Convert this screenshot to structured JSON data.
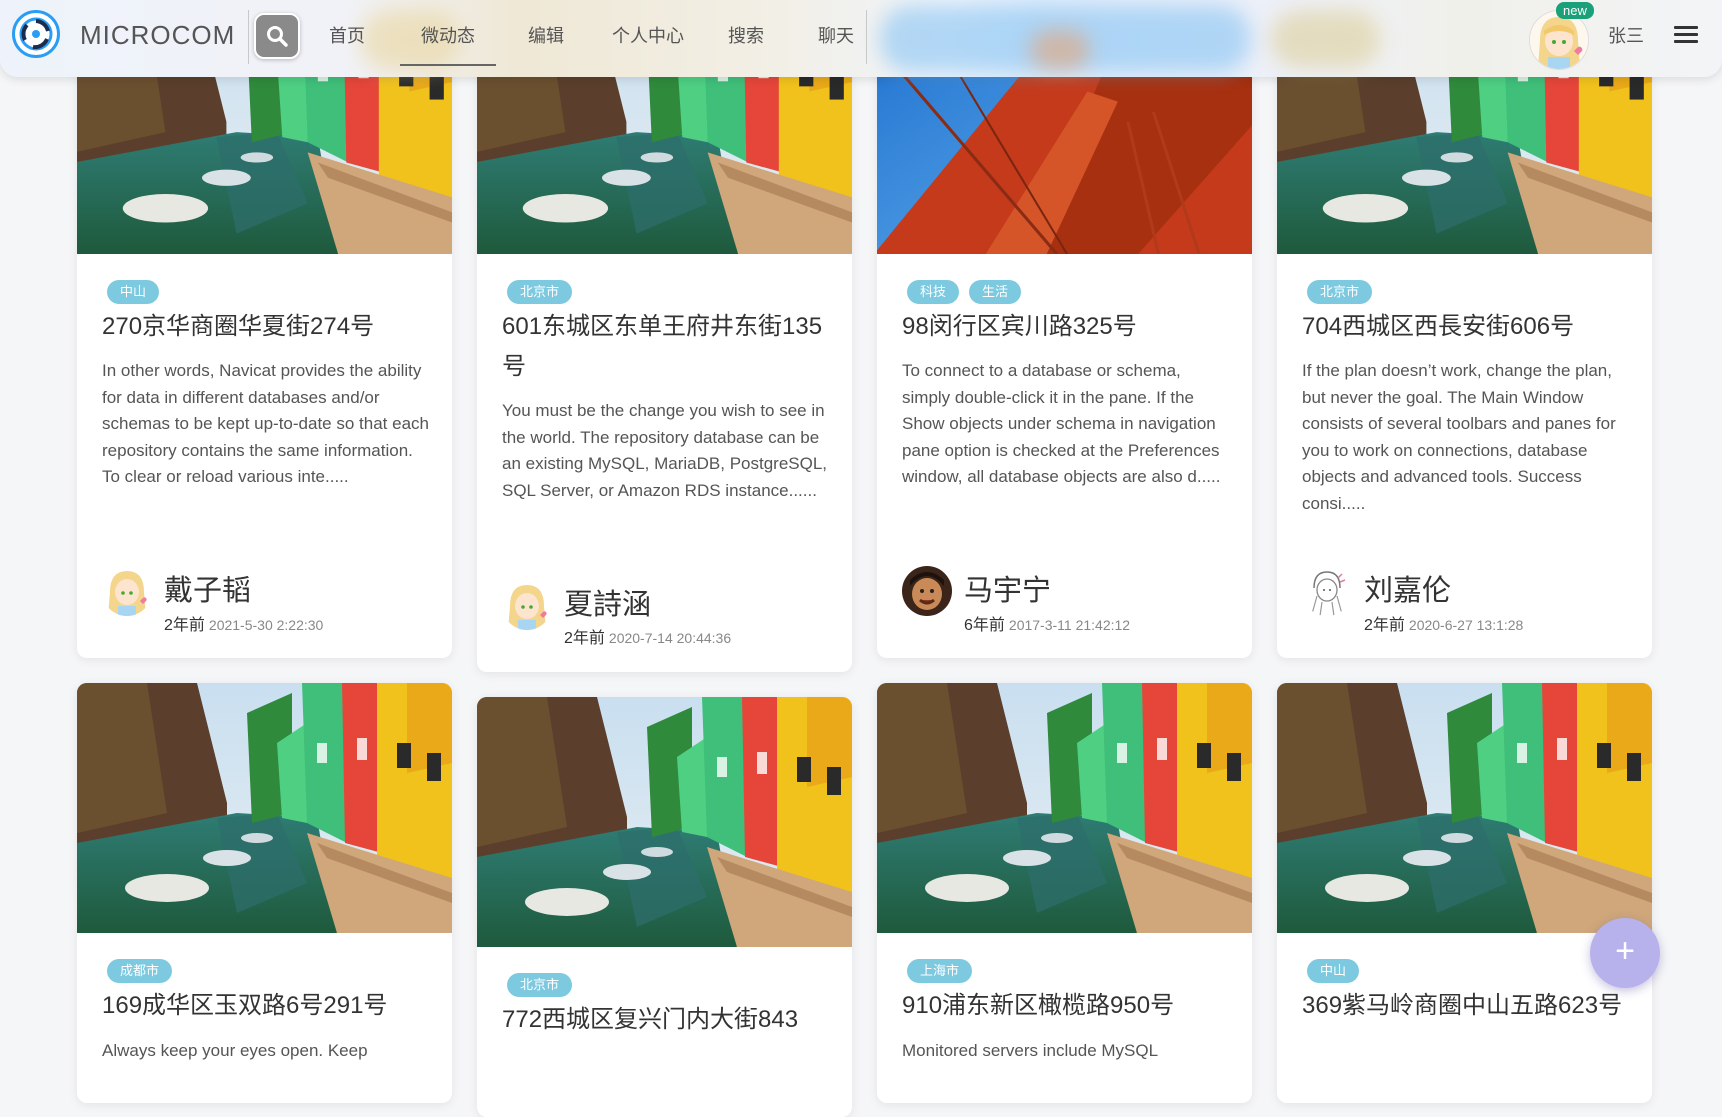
{
  "header": {
    "brand": "MICROCOM",
    "nav": [
      {
        "label": "首页",
        "name": "nav-home"
      },
      {
        "label": "微动态",
        "name": "nav-moments",
        "active": true
      },
      {
        "label": "编辑",
        "name": "nav-edit"
      },
      {
        "label": "个人中心",
        "name": "nav-profile"
      },
      {
        "label": "搜索",
        "name": "nav-search"
      },
      {
        "label": "聊天",
        "name": "nav-chat"
      }
    ],
    "badge": "new",
    "username": "张三",
    "icons": {
      "logo": "microcom-logo-icon",
      "search": "search-icon",
      "menu": "hamburger-menu-icon"
    }
  },
  "posts": [
    {
      "tags": [
        "中山"
      ],
      "title": "270京华商圈华夏街274号",
      "desc": "In other words, Navicat provides the ability for data in different databases and/or schemas to be kept up-to-date so that each repository contains the same information. To clear or reload various inte.....",
      "author": "戴子韬",
      "ago": "2年前",
      "time": "2021-5-30 2:22:30",
      "image": "canal-houses"
    },
    {
      "tags": [
        "北京市"
      ],
      "title": "601东城区东单王府井东街135号",
      "desc": "You must be the change you wish to see in the world. The repository database can be an existing MySQL, MariaDB, PostgreSQL, SQL Server, or Amazon RDS instance......",
      "author": "夏詩涵",
      "ago": "2年前",
      "time": "2020-7-14 20:44:36",
      "image": "canal-houses"
    },
    {
      "tags": [
        "科技",
        "生活"
      ],
      "title": "98闵行区宾川路325号",
      "desc": "To connect to a database or schema, simply double-click it in the pane. If the Show objects under schema in navigation pane option is checked at the Preferences window, all database objects are also d.....",
      "author": "马宇宁",
      "ago": "6年前",
      "time": "2017-3-11 21:42:12",
      "image": "red-bridge"
    },
    {
      "tags": [
        "北京市"
      ],
      "title": "704西城区西長安街606号",
      "desc": "If the plan doesn’t work, change the plan, but never the goal. The Main Window consists of several toolbars and panes for you to work on connections, database objects and advanced tools. Success consi.....",
      "author": "刘嘉伦",
      "ago": "2年前",
      "time": "2020-6-27 13:1:28",
      "image": "canal-houses"
    },
    {
      "tags": [
        "成都市"
      ],
      "title": "169成华区玉双路6号291号",
      "desc": "Always keep your eyes open. Keep",
      "image": "canal-houses"
    },
    {
      "tags": [
        "北京市"
      ],
      "title": "772西城区复兴门内大街843",
      "desc": "",
      "image": "canal-houses"
    },
    {
      "tags": [
        "上海市"
      ],
      "title": "910浦东新区橄榄路950号",
      "desc": "Monitored servers include MySQL",
      "image": "canal-houses"
    },
    {
      "tags": [
        "中山"
      ],
      "title": "369紫马岭商圈中山五路623号",
      "desc": "",
      "image": "canal-houses"
    }
  ],
  "fab": {
    "label": "+",
    "icon": "plus-icon"
  },
  "colors": {
    "tag": "#7cc9e0",
    "badge": "#1aa179",
    "fab": "#b8b2ec",
    "logo": "#2a9df4"
  }
}
